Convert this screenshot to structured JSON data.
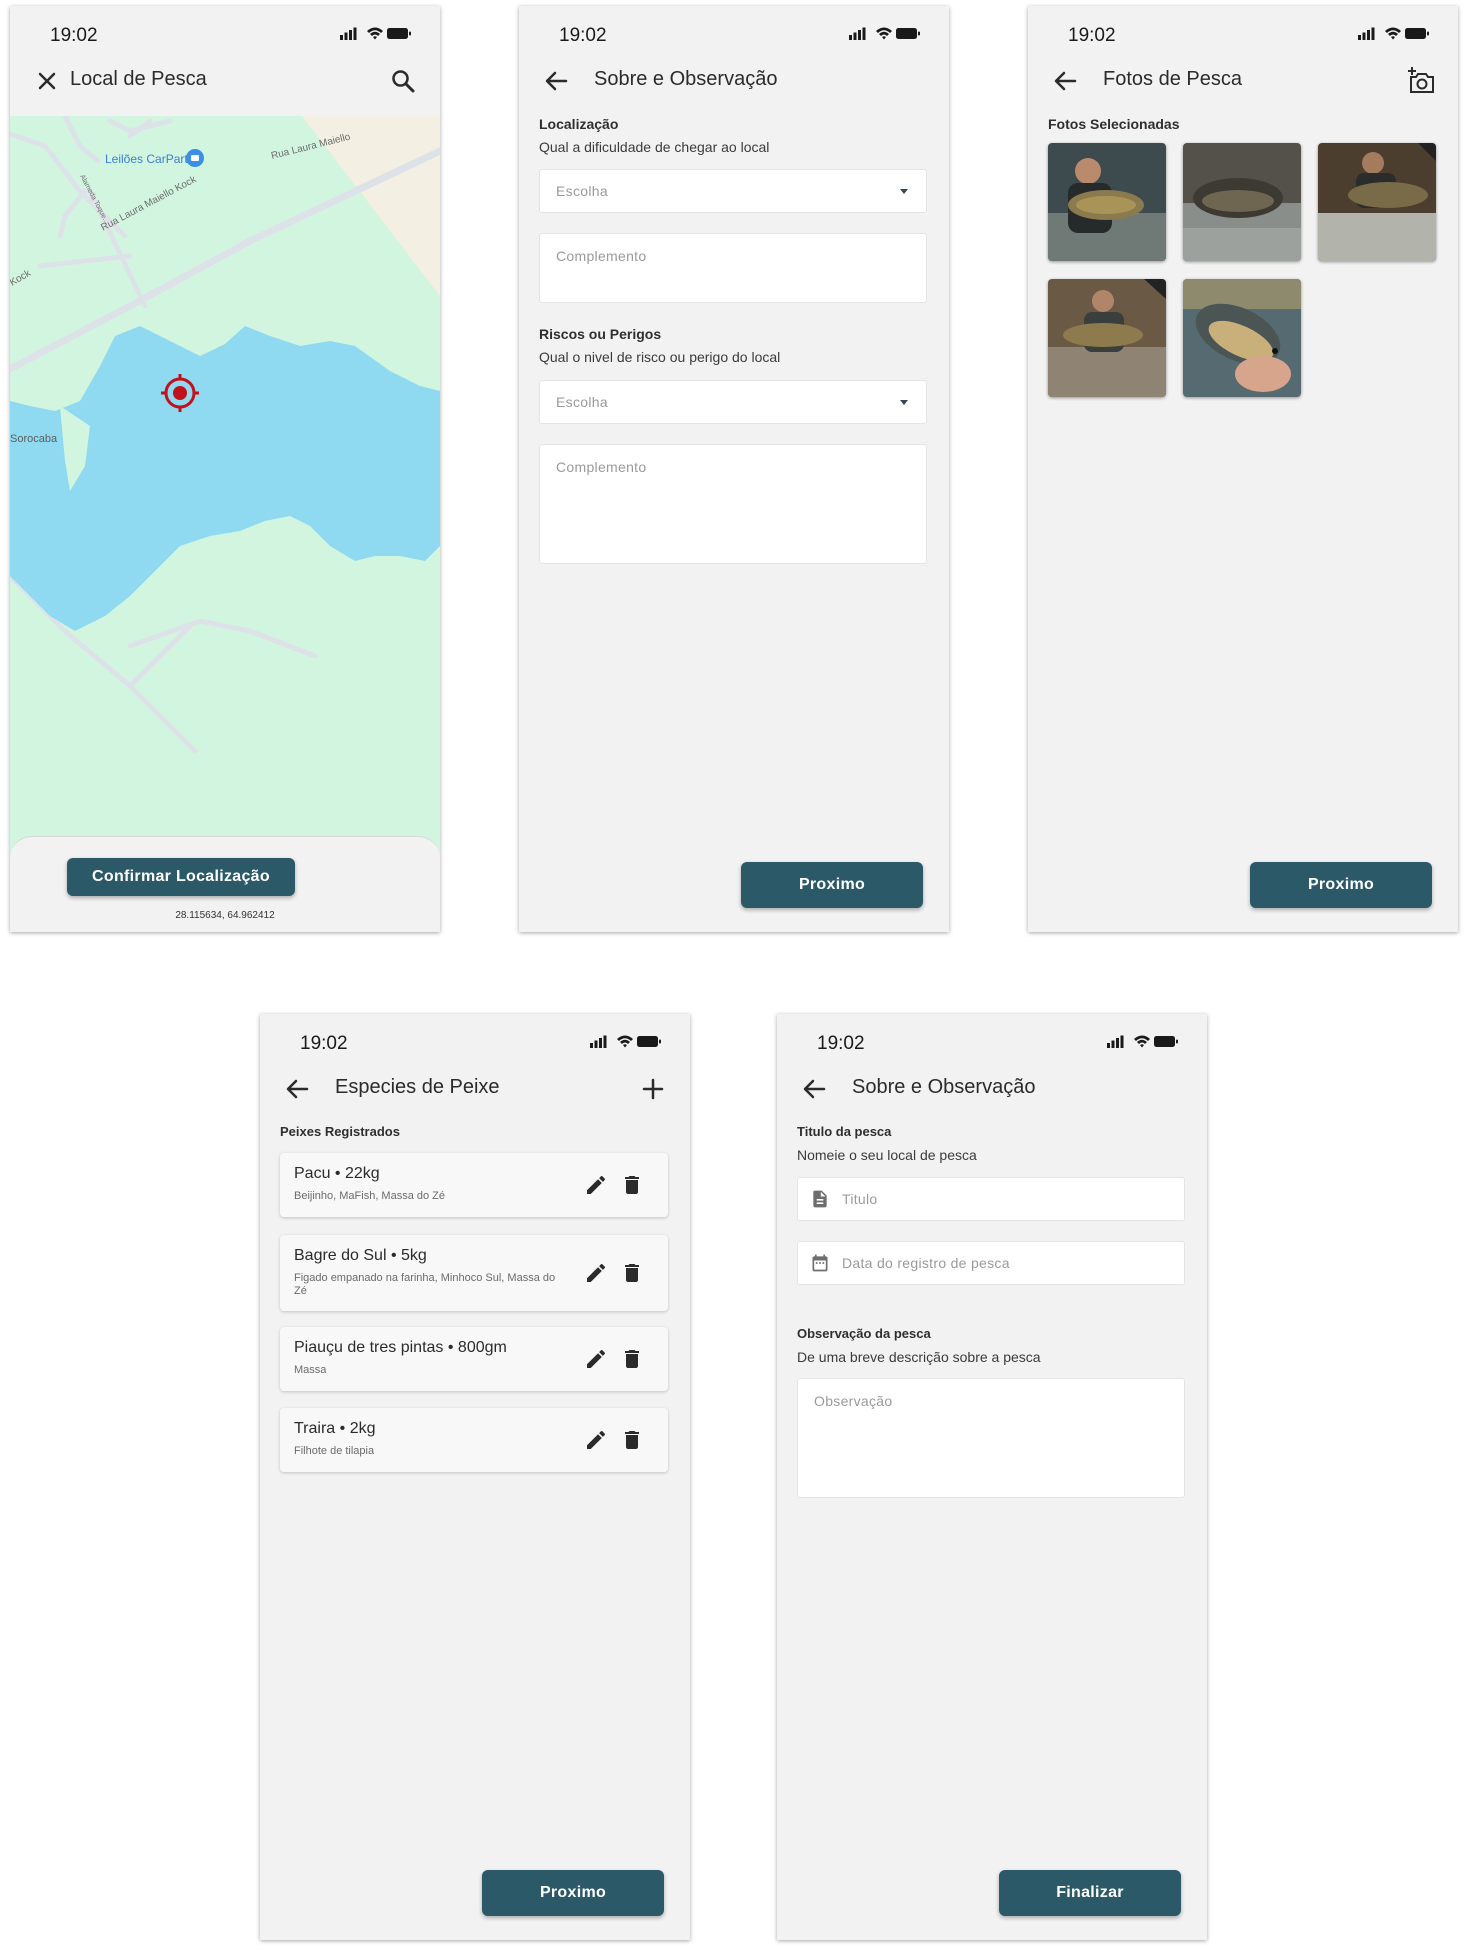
{
  "status": {
    "time": "19:02"
  },
  "screen1": {
    "title": "Local de Pesca",
    "leading_icon": "close-icon",
    "trailing_icon": "search-icon",
    "map": {
      "poi": "Leilões CarPart",
      "street1": "Rua Laura Maiello Kock",
      "street2": "Rua Laura Maiello",
      "street3": "Kock",
      "street4": "Alameda Toque...",
      "place": "Sorocaba"
    },
    "confirm_label": "Confirmar Localização",
    "coordinates": "28.115634, 64.962412"
  },
  "screen2": {
    "title": "Sobre e Observação",
    "leading_icon": "arrow-back-icon",
    "section1_label": "Localização",
    "section1_sub": "Qual a dificuldade de chegar ao local",
    "select1_placeholder": "Escolha",
    "textarea1_placeholder": "Complemento",
    "section2_label": "Riscos ou Perigos",
    "section2_sub": "Qual o nivel de risco ou perigo do local",
    "select2_placeholder": "Escolha",
    "textarea2_placeholder": "Complemento",
    "next_label": "Proximo"
  },
  "screen3": {
    "title": "Fotos de Pesca",
    "leading_icon": "arrow-back-icon",
    "trailing_icon": "add-camera-icon",
    "section_label": "Fotos Selecionadas",
    "photo_count": 5,
    "next_label": "Proximo"
  },
  "screen4": {
    "title": "Especies de Peixe",
    "leading_icon": "arrow-back-icon",
    "trailing_icon": "plus-icon",
    "section_label": "Peixes Registrados",
    "fish": [
      {
        "name": "Pacu",
        "weight": "22kg",
        "desc": "Beijinho, MaFish, Massa do Zé"
      },
      {
        "name": "Bagre do Sul",
        "weight": "5kg",
        "desc": "Figado empanado na farinha, Minhoco Sul, Massa do Zé"
      },
      {
        "name": "Piauçu de tres pintas",
        "weight": "800gm",
        "desc": "Massa"
      },
      {
        "name": "Traira",
        "weight": "2kg",
        "desc": "Filhote de tilapia"
      }
    ],
    "next_label": "Proximo"
  },
  "screen5": {
    "title": "Sobre e Observação",
    "leading_icon": "arrow-back-icon",
    "section1_label": "Titulo da pesca",
    "section1_sub": "Nomeie o seu local de pesca",
    "title_placeholder": "Titulo",
    "date_placeholder": "Data do registro de pesca",
    "section2_label": "Observação da pesca",
    "section2_sub": "De uma breve descrição sobre a pesca",
    "obs_placeholder": "Observação",
    "finish_label": "Finalizar"
  },
  "colors": {
    "primary_button": "#2b5968",
    "background": "#f2f2f2",
    "map_land": "#d2f5e0",
    "map_water": "#8fdaf0",
    "target_marker": "#c0121c"
  }
}
